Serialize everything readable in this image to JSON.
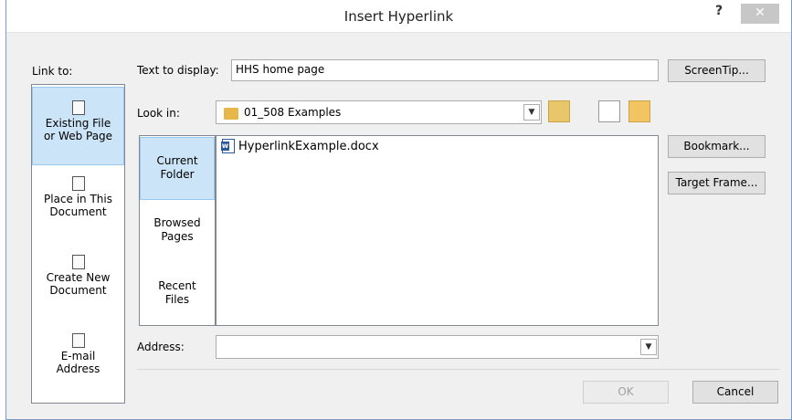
{
  "window": {
    "title": "Insert Hyperlink",
    "help_label": "?",
    "close_label": "✕"
  },
  "link_to": {
    "heading": "Link to:",
    "items": [
      {
        "line1": "Existing File",
        "line2": "or Web Page",
        "selected": true,
        "icon": "existing-file-icon"
      },
      {
        "line1": "Place in This",
        "line2": "Document",
        "selected": false,
        "icon": "place-in-document-icon"
      },
      {
        "line1": "Create New",
        "line2": "Document",
        "selected": false,
        "icon": "create-document-icon"
      },
      {
        "line1": "E-mail",
        "line2": "Address",
        "selected": false,
        "icon": "email-icon"
      }
    ]
  },
  "text_to_display": {
    "label": "Text to display:",
    "value": "HHS home page"
  },
  "look_in": {
    "label": "Look in:",
    "value": "01_508 Examples"
  },
  "side_tabs": [
    {
      "line1": "Current",
      "line2": "Folder",
      "selected": true
    },
    {
      "line1": "Browsed",
      "line2": "Pages",
      "selected": false
    },
    {
      "line1": "Recent",
      "line2": "Files",
      "selected": false
    }
  ],
  "files": [
    {
      "name": "HyperlinkExample.docx",
      "icon": "word-document-icon"
    }
  ],
  "address": {
    "label": "Address:",
    "value": ""
  },
  "buttons": {
    "screentip": "ScreenTip...",
    "bookmark": "Bookmark...",
    "target_frame": "Target Frame...",
    "ok": "OK",
    "cancel": "Cancel"
  },
  "colors": {
    "selection": "#cce4f7",
    "frame_border": "#7a9cc8",
    "dialog_bg": "#f0f0f0"
  }
}
